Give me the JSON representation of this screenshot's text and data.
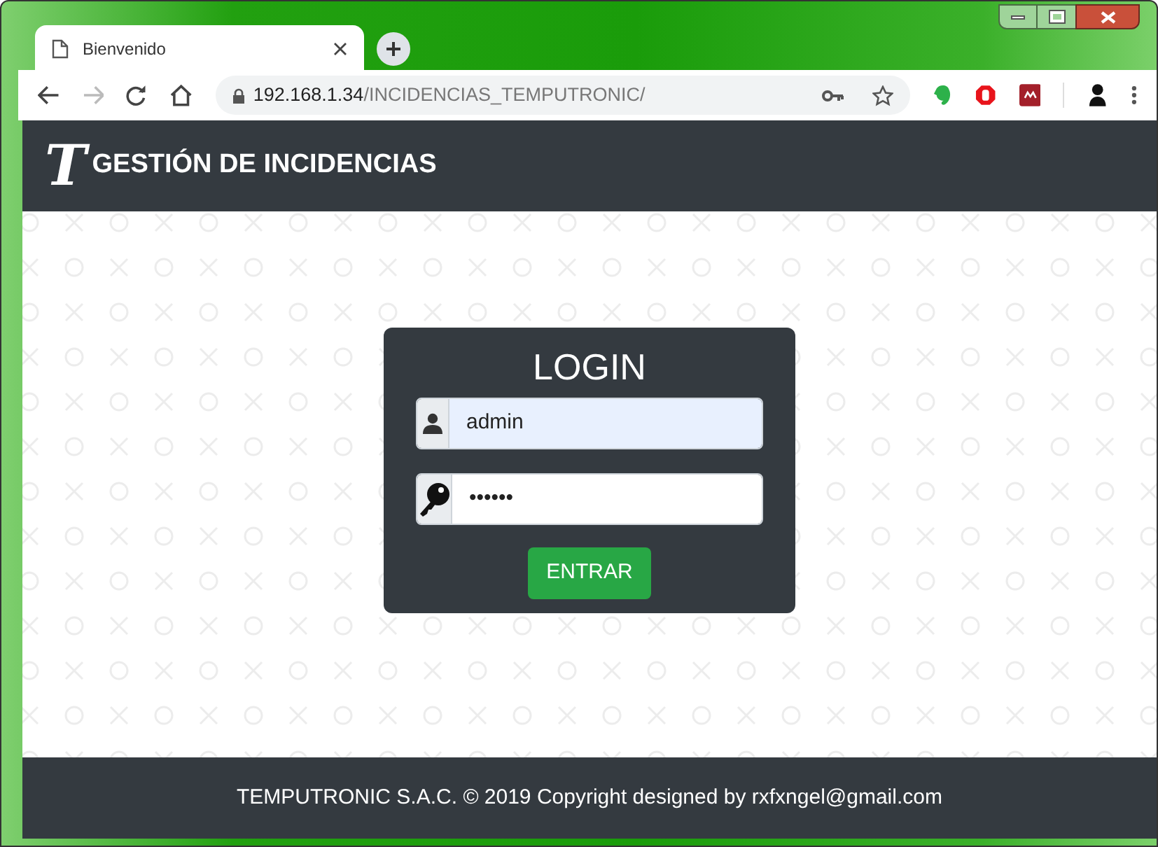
{
  "browser": {
    "tab": {
      "title": "Bienvenido",
      "selected": true
    },
    "address": {
      "host": "192.168.1.34",
      "path": "/INCIDENCIAS_TEMPUTRONIC/"
    }
  },
  "header": {
    "logo": "T",
    "title": "GESTIÓN DE INCIDENCIAS"
  },
  "login": {
    "title": "LOGIN",
    "fields": [
      {
        "kind": "user",
        "value": "admin",
        "autofilled": true
      },
      {
        "kind": "password",
        "value": "••••••",
        "autofilled": false
      }
    ],
    "button": "ENTRAR"
  },
  "footer": "TEMPUTRONIC S.A.C. © 2019 Copyright designed by rxfxngel@gmail.com"
}
